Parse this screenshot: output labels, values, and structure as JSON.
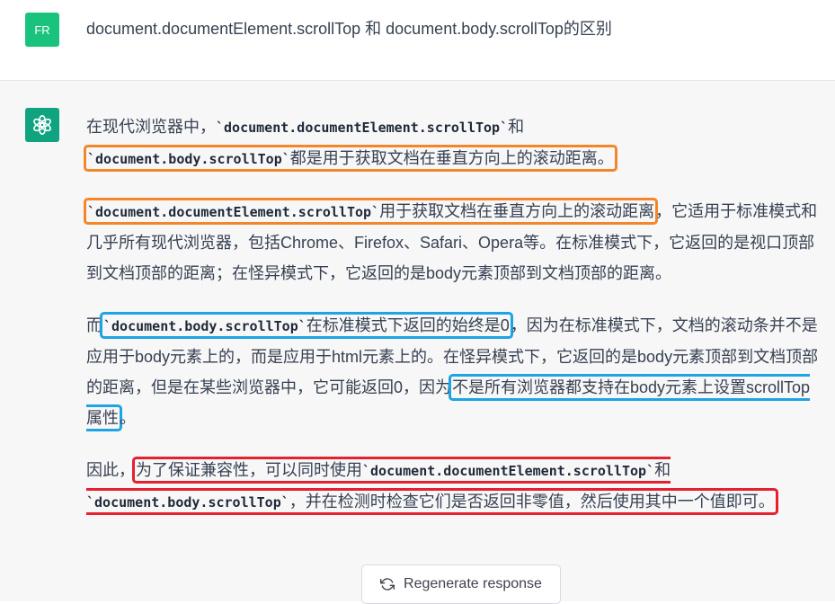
{
  "user": {
    "avatar_initials": "FR",
    "avatar_color": "#19c37d",
    "message": "document.documentElement.scrollTop 和 document.body.scrollTop的区别"
  },
  "assistant": {
    "icon": "openai-logo-icon",
    "icon_color": "#10a37f",
    "paragraphs": {
      "p1": {
        "t1": "在现代浏览器中，",
        "c1": "`document.documentElement.scrollTop`",
        "t2": "和",
        "c2": "`document.body.scrollTop`",
        "t3": "都是用于获取文档在垂直方向上的滚动距离。"
      },
      "p2": {
        "c1": "`document.documentElement.scrollTop`",
        "t1": "用于获取文档在垂直方向上的滚动距离",
        "t2": "，它适用于标准模式和几乎所有现代浏览器，包括Chrome、Firefox、Safari、Opera等。在标准模式下，它返回的是视口顶部到文档顶部的距离；在怪异模式下，它返回的是body元素顶部到文档顶部的距离。"
      },
      "p3": {
        "t1": "而",
        "c1": "`document.body.scrollTop`",
        "t2": "在标准模式下返回的始终是0",
        "t3": "，因为在标准模式下，文档的滚动条并不是应用于body元素上的，而是应用于html元素上的。在怪异模式下，它返回的是body元素顶部到文档顶部的距离，但是在某些浏览器中，它可能返回0，因为",
        "t4": "不是所有浏览器都支持在body元素上设置scrollTop属性",
        "t5": "。"
      },
      "p4": {
        "t1": "因此，",
        "t2": "为了保证兼容性，可以同时使用",
        "c1": "`document.documentElement.scrollTop`",
        "t3": "和",
        "c2": "`document.body.scrollTop`",
        "t4": "，并在检测时检查它们是否返回非零值，然后使用其中一个值即可。"
      }
    }
  },
  "regenerate": {
    "label": "Regenerate response",
    "icon": "refresh-icon"
  },
  "highlight_colors": {
    "orange": "#f4862a",
    "blue": "#1ea3e3",
    "red": "#e5202f"
  }
}
